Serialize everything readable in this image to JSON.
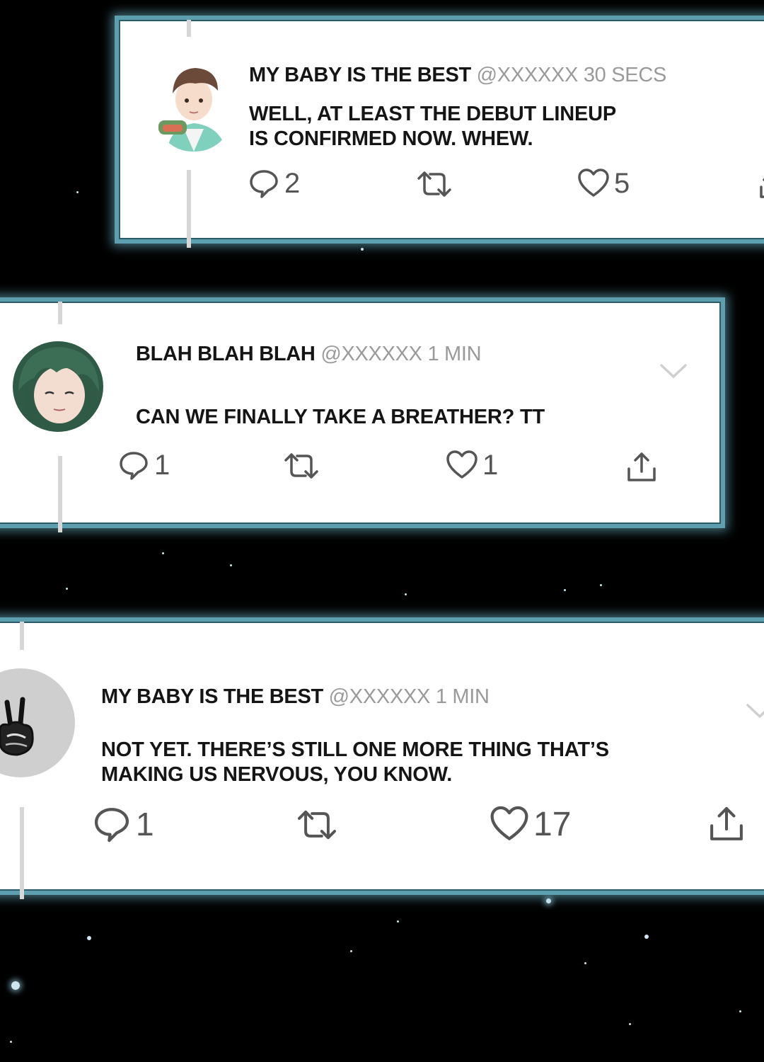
{
  "tweets": [
    {
      "name": "MY BABY IS THE BEST",
      "handle": "@XXXXXX 30 SECS",
      "text": "WELL, AT LEAST THE DEBUT LINEUP\nIS CONFIRMED NOW. WHEW.",
      "replies": "2",
      "likes": "5",
      "avatar_icon": "anime-boy-brown-hair-avatar"
    },
    {
      "name": "BLAH BLAH BLAH",
      "handle": "@XXXXXX 1 MIN",
      "text": "CAN WE FINALLY TAKE A BREATHER? TT",
      "replies": "1",
      "likes": "1",
      "avatar_icon": "anime-boy-green-hair-avatar"
    },
    {
      "name": "MY BABY IS THE BEST",
      "handle": "@XXXXXX 1 MIN",
      "text": "NOT YET. THERE’S STILL ONE MORE THING THAT’S\nMAKING US NERVOUS, YOU KNOW.",
      "replies": "1",
      "likes": "17",
      "avatar_icon": "peace-sign-hand-avatar"
    }
  ],
  "colors": {
    "background": "#000000",
    "card_border": "#5d9fae",
    "text": "#151515",
    "muted": "#9a9a9a",
    "icon": "#555555"
  }
}
